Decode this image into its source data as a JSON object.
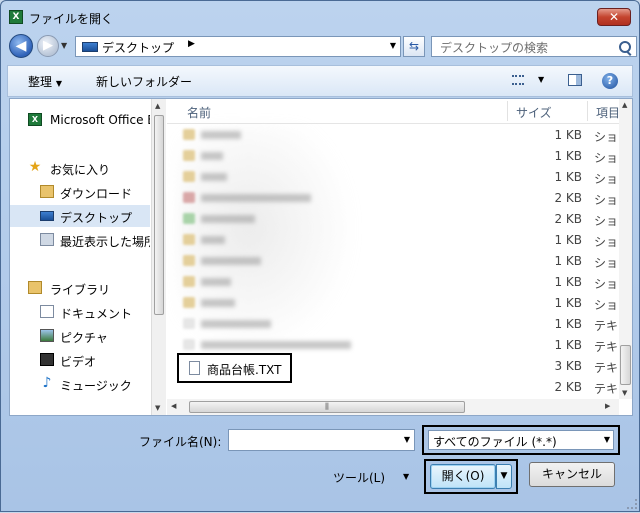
{
  "window": {
    "title": "ファイルを開く",
    "close_symbol": "✕"
  },
  "nav": {
    "address": "デスクトップ",
    "address_sep": "▶",
    "search_placeholder": "デスクトップの検索"
  },
  "toolbar": {
    "organize": "整理",
    "new_folder": "新しいフォルダー",
    "help": "?"
  },
  "sidebar": {
    "items": [
      {
        "label": "Microsoft Office E",
        "icon": "excel-icon"
      },
      {
        "label": "お気に入り",
        "icon": "star-icon"
      },
      {
        "label": "ダウンロード",
        "icon": "downloads-folder-icon"
      },
      {
        "label": "デスクトップ",
        "icon": "desktop-icon"
      },
      {
        "label": "最近表示した場所",
        "icon": "recent-places-icon"
      },
      {
        "label": "ライブラリ",
        "icon": "library-icon"
      },
      {
        "label": "ドキュメント",
        "icon": "documents-icon"
      },
      {
        "label": "ピクチャ",
        "icon": "pictures-icon"
      },
      {
        "label": "ビデオ",
        "icon": "videos-icon"
      },
      {
        "label": "ミュージック",
        "icon": "music-icon"
      }
    ]
  },
  "filelist": {
    "columns": {
      "name": "名前",
      "size": "サイズ",
      "type": "項目"
    },
    "rows": [
      {
        "size": "1 KB",
        "type": "ショ"
      },
      {
        "size": "1 KB",
        "type": "ショ"
      },
      {
        "size": "1 KB",
        "type": "ショ"
      },
      {
        "size": "2 KB",
        "type": "ショ"
      },
      {
        "size": "2 KB",
        "type": "ショ"
      },
      {
        "size": "1 KB",
        "type": "ショ"
      },
      {
        "size": "1 KB",
        "type": "ショ"
      },
      {
        "size": "1 KB",
        "type": "ショ"
      },
      {
        "size": "1 KB",
        "type": "ショ"
      },
      {
        "size": "1 KB",
        "type": "テキ"
      },
      {
        "size": "1 KB",
        "type": "テキ"
      },
      {
        "size": "3 KB",
        "type": "テキ"
      },
      {
        "size": "2 KB",
        "type": "テキ"
      }
    ],
    "highlighted_file": "商品台帳.TXT"
  },
  "bottom": {
    "filename_label": "ファイル名(N):",
    "filename_value": "",
    "filter": "すべてのファイル (*.*)",
    "tools": "ツール(L)",
    "open": "開く(O)",
    "cancel": "キャンセル"
  }
}
